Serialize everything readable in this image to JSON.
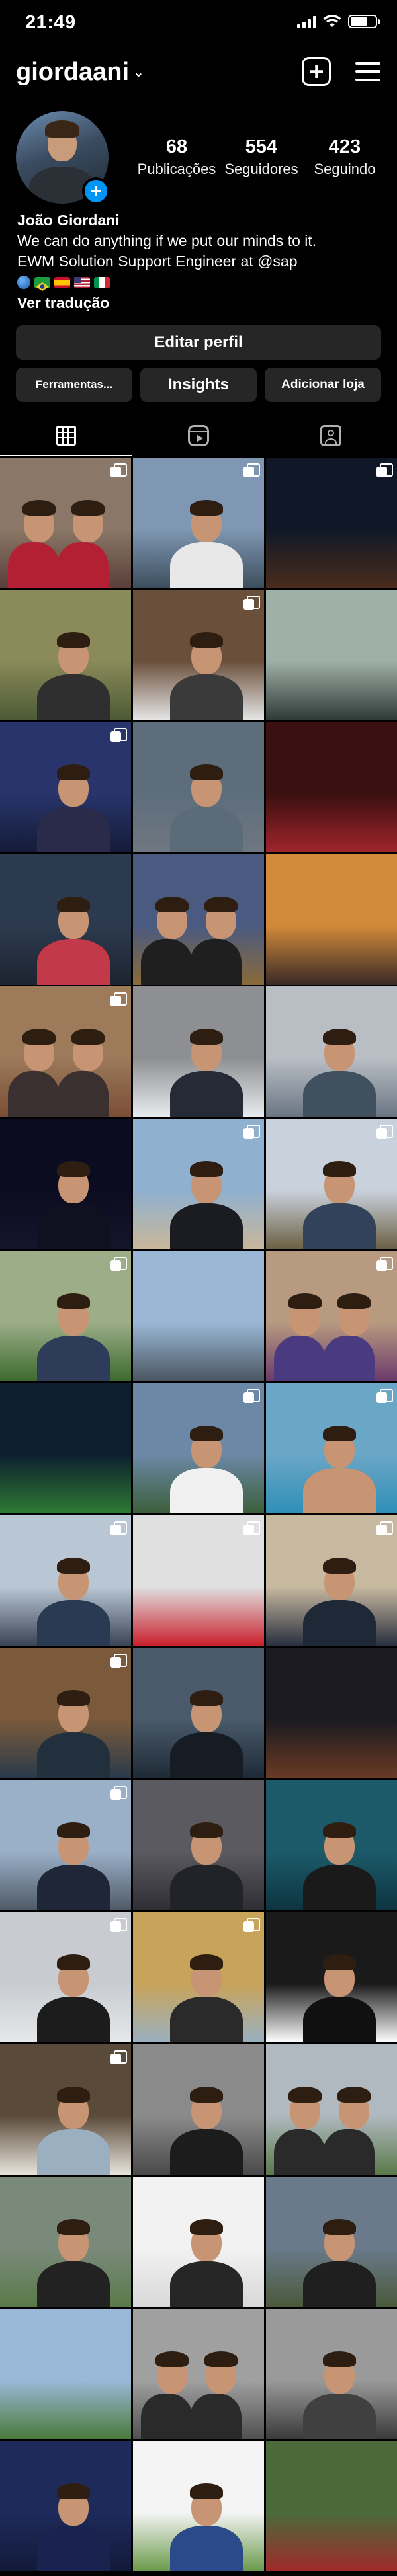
{
  "status_bar": {
    "time": "21:49"
  },
  "header": {
    "username": "giordaani"
  },
  "profile": {
    "add_badge": "+",
    "stats": [
      {
        "value": "68",
        "label": "Publicações"
      },
      {
        "value": "554",
        "label": "Seguidores"
      },
      {
        "value": "423",
        "label": "Seguindo"
      }
    ],
    "name": "João Giordani",
    "bio_lines": [
      "We can do anything if we put our minds to it.",
      "EWM Solution Support Engineer at @sap"
    ],
    "flag_icons": [
      "globe-icon",
      "brazil-flag-icon",
      "spain-flag-icon",
      "usa-flag-icon",
      "italy-flag-icon"
    ],
    "translate_label": "Ver tradução"
  },
  "buttons": {
    "edit_profile": "Editar perfil",
    "tools": "Ferramentas...",
    "insights": "Insights",
    "add_shop": "Adicionar loja"
  },
  "tabs": [
    {
      "icon": "grid-icon",
      "active": true
    },
    {
      "icon": "reels-icon",
      "active": false
    },
    {
      "icon": "tagged-icon",
      "active": false
    }
  ],
  "posts": [
    {
      "bg": [
        "#8a7767",
        "#5a3f3a"
      ],
      "people": 2,
      "shirt": "#b32034",
      "multi": true
    },
    {
      "bg": [
        "#7f97b3",
        "#3d4f5e"
      ],
      "people": 1,
      "shirt": "#e8e8e8",
      "multi": true
    },
    {
      "bg": [
        "#101828",
        "#4a2c1c"
      ],
      "people": 0,
      "shirt": "#000000",
      "multi": true
    },
    {
      "bg": [
        "#8a8a5a",
        "#4c5a34"
      ],
      "people": 1,
      "shirt": "#2f2f2f",
      "multi": false
    },
    {
      "bg": [
        "#6a4f3b",
        "#e6e6e6"
      ],
      "people": 1,
      "shirt": "#3a3a3a",
      "multi": true
    },
    {
      "bg": [
        "#9fb0a8",
        "#2e3b36"
      ],
      "people": 0,
      "shirt": "#000000",
      "multi": false
    },
    {
      "bg": [
        "#28346b",
        "#141c38"
      ],
      "people": 1,
      "shirt": "#2a2a4a",
      "multi": true
    },
    {
      "bg": [
        "#5d6d7c",
        "#6f7780"
      ],
      "people": 1,
      "shirt": "#5b6b78",
      "multi": false
    },
    {
      "bg": [
        "#3a1010",
        "#a0242c"
      ],
      "people": 0,
      "shirt": "#000000",
      "multi": false
    },
    {
      "bg": [
        "#2c3a4f",
        "#1e2430"
      ],
      "people": 1,
      "shirt": "#c23a4a",
      "multi": false
    },
    {
      "bg": [
        "#4a5a80",
        "#8a6a3a"
      ],
      "people": 2,
      "shirt": "#1f1f1f",
      "multi": false
    },
    {
      "bg": [
        "#d28a3a",
        "#3a2a28"
      ],
      "people": 0,
      "shirt": "#000000",
      "multi": false
    },
    {
      "bg": [
        "#9c7a5a",
        "#7a4e36"
      ],
      "people": 2,
      "shirt": "#3a3030",
      "multi": true
    },
    {
      "bg": [
        "#8d8f93",
        "#e9ecef"
      ],
      "people": 1,
      "shirt": "#262a36",
      "multi": false
    },
    {
      "bg": [
        "#b9bec4",
        "#6b7684"
      ],
      "people": 1,
      "shirt": "#40505e",
      "multi": false
    },
    {
      "bg": [
        "#0c0c20",
        "#14142c"
      ],
      "people": 1,
      "shirt": "#101020",
      "multi": false
    },
    {
      "bg": [
        "#8fb0cf",
        "#c9b79b"
      ],
      "people": 1,
      "shirt": "#1b1b22",
      "multi": true
    },
    {
      "bg": [
        "#c9d2dc",
        "#6c6045"
      ],
      "people": 1,
      "shirt": "#32425a",
      "multi": true
    },
    {
      "bg": [
        "#9cad87",
        "#3d6a2f"
      ],
      "people": 1,
      "shirt": "#2e3c5a",
      "multi": true
    },
    {
      "bg": [
        "#9ab8d6",
        "#4a5560"
      ],
      "people": 0,
      "shirt": "#000000",
      "multi": false
    },
    {
      "bg": [
        "#b89a80",
        "#6a3a6a"
      ],
      "people": 2,
      "shirt": "#4a3a80",
      "multi": true
    },
    {
      "bg": [
        "#0d1f2e",
        "#2e7a34"
      ],
      "people": 0,
      "shirt": "#000000",
      "multi": false
    },
    {
      "bg": [
        "#6b88a6",
        "#3c5e3a"
      ],
      "people": 1,
      "shirt": "#f0f0f0",
      "multi": true
    },
    {
      "bg": [
        "#6aa6c6",
        "#2f8fb8"
      ],
      "people": 1,
      "shirt": "#c79574",
      "multi": true
    },
    {
      "bg": [
        "#b9c6d3",
        "#3a4555"
      ],
      "people": 1,
      "shirt": "#2a3a52",
      "multi": true
    },
    {
      "bg": [
        "#e0e0e0",
        "#c8202c"
      ],
      "people": 0,
      "shirt": "#000000",
      "multi": true
    },
    {
      "bg": [
        "#c7b8a0",
        "#2a3040"
      ],
      "people": 1,
      "shirt": "#1f2836",
      "multi": true
    },
    {
      "bg": [
        "#7a5a3a",
        "#2a3a4a"
      ],
      "people": 1,
      "shirt": "#22303e",
      "multi": true
    },
    {
      "bg": [
        "#4a5a6a",
        "#1e2a36"
      ],
      "people": 1,
      "shirt": "#161c24",
      "multi": false
    },
    {
      "bg": [
        "#1a1a20",
        "#6a3a24"
      ],
      "people": 0,
      "shirt": "#000000",
      "multi": false
    },
    {
      "bg": [
        "#9ab0c8",
        "#505a66"
      ],
      "people": 1,
      "shirt": "#1e2638",
      "multi": true
    },
    {
      "bg": [
        "#5a5a60",
        "#2e2e34"
      ],
      "people": 1,
      "shirt": "#202428",
      "multi": false
    },
    {
      "bg": [
        "#1c5a6a",
        "#0e3440"
      ],
      "people": 1,
      "shirt": "#1a1a1a",
      "multi": false
    },
    {
      "bg": [
        "#c8ccd0",
        "#e6e8ea"
      ],
      "people": 1,
      "shirt": "#1c1c1c",
      "multi": true
    },
    {
      "bg": [
        "#c8a35a",
        "#9ab0c0"
      ],
      "people": 1,
      "shirt": "#2a2a2a",
      "multi": true
    },
    {
      "bg": [
        "#1a1a1a",
        "#ffffff"
      ],
      "people": 1,
      "shirt": "#101010",
      "multi": false
    },
    {
      "bg": [
        "#5a4a3a",
        "#e8e4dc"
      ],
      "people": 1,
      "shirt": "#9ab0c0",
      "multi": true
    },
    {
      "bg": [
        "#8a8a8a",
        "#4a4a4a"
      ],
      "people": 1,
      "shirt": "#1c1c1c",
      "multi": false
    },
    {
      "bg": [
        "#b0b8c0",
        "#5a7a4a"
      ],
      "people": 2,
      "shirt": "#2a2a2a",
      "multi": false
    },
    {
      "bg": [
        "#7a8a7a",
        "#5a7a4a"
      ],
      "people": 1,
      "shirt": "#222222",
      "multi": false
    },
    {
      "bg": [
        "#f2f2f2",
        "#d8d8d8"
      ],
      "people": 1,
      "shirt": "#262626",
      "multi": false
    },
    {
      "bg": [
        "#6a7a8a",
        "#4a5a3a"
      ],
      "people": 1,
      "shirt": "#1f1f1f",
      "multi": false
    },
    {
      "bg": [
        "#9ab8d8",
        "#4a7a3a"
      ],
      "people": 0,
      "shirt": "#000000",
      "multi": false
    },
    {
      "bg": [
        "#a0a0a0",
        "#505050"
      ],
      "people": 2,
      "shirt": "#2a2a2a",
      "multi": false
    },
    {
      "bg": [
        "#9a9a9a",
        "#3a3a3a"
      ],
      "people": 1,
      "shirt": "#404040",
      "multi": false
    },
    {
      "bg": [
        "#1e2a5a",
        "#121a3a"
      ],
      "people": 1,
      "shirt": "#1a2250",
      "multi": false
    },
    {
      "bg": [
        "#f4f4f4",
        "#6a9a4a"
      ],
      "people": 1,
      "shirt": "#2a4a8a",
      "multi": false
    },
    {
      "bg": [
        "#4a6a3a",
        "#a02a2a"
      ],
      "people": 0,
      "shirt": "#000000",
      "multi": false
    }
  ]
}
